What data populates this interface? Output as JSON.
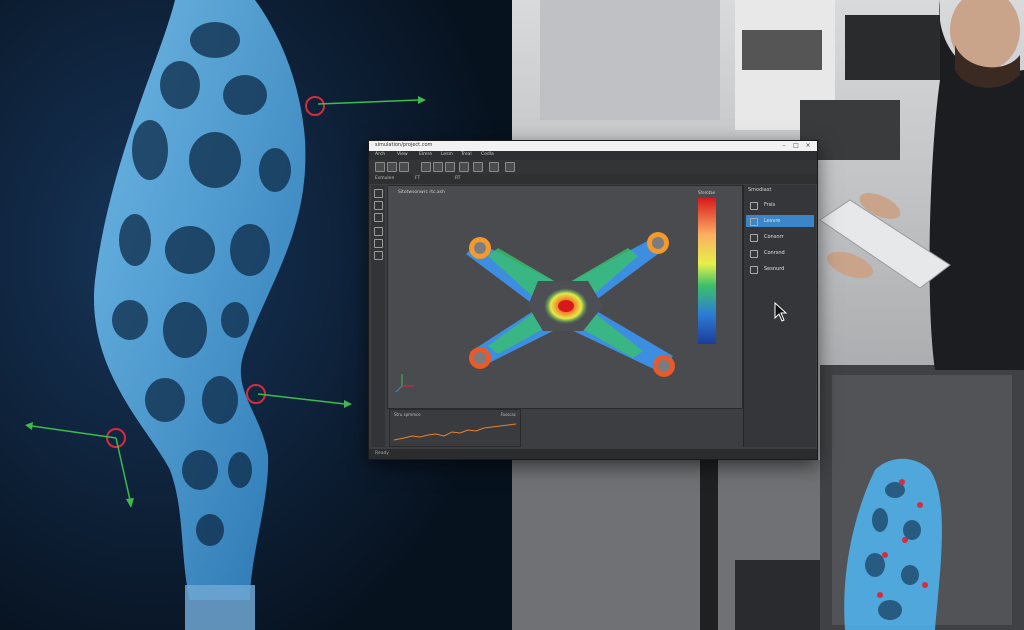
{
  "window": {
    "title": "simulation/project.com",
    "controls": [
      "–",
      "□",
      "×"
    ]
  },
  "menu": [
    "Arch",
    "View",
    "Elmre",
    "Lesm",
    "Treal",
    "Cedla"
  ],
  "subbar": {
    "view_label": "Esmulen",
    "extra": [
      "FT",
      "RT"
    ]
  },
  "viewport": {
    "title": "Sitotwsonwrc rtc.ash",
    "colorbar_label": "Sterotae"
  },
  "chart_panel": {
    "title": "Stru spmmce",
    "value_label": "Fasscac"
  },
  "right_panel": {
    "header": "Smodiast",
    "items": [
      {
        "label": "Frsis",
        "icon": "frame-icon",
        "active": false
      },
      {
        "label": "Lesvre",
        "icon": "layers-icon",
        "active": true
      },
      {
        "label": "Consnrr",
        "icon": "constraint-icon",
        "active": false
      },
      {
        "label": "Conrsnd",
        "icon": "load-icon",
        "active": false
      },
      {
        "label": "Sesnurd",
        "icon": "results-icon",
        "active": false
      }
    ]
  },
  "status": {
    "text": "Ready"
  },
  "colors": {
    "accent": "#3b86c9",
    "lattice": "#4fb6f2",
    "background": "#0b1a2c",
    "marker": "#d62c3b",
    "axis_arrow": "#3dbb4e"
  }
}
